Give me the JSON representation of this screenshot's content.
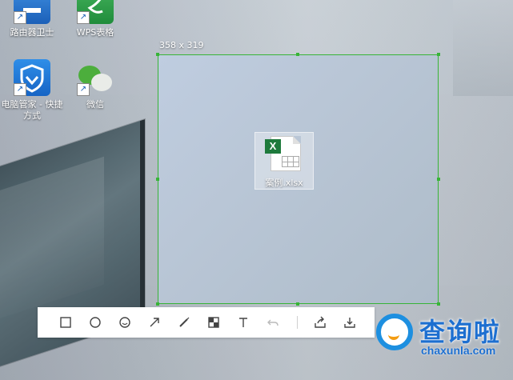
{
  "desktop": {
    "icons": [
      {
        "label": "路由器卫士",
        "icon": "router-guard-icon"
      },
      {
        "label": "WPS表格",
        "icon": "wps-spreadsheet-icon"
      },
      {
        "label": "电脑管家 - 快捷方式",
        "icon": "pc-manager-icon"
      },
      {
        "label": "微信",
        "icon": "wechat-icon"
      }
    ]
  },
  "capture": {
    "size_label": "358 x 319",
    "accent_color": "#37b437"
  },
  "file": {
    "name": "案例.xlsx",
    "badge": "X",
    "icon": "excel-file-icon"
  },
  "toolbar": {
    "tools": [
      {
        "name": "rectangle-tool",
        "icon": "square-icon"
      },
      {
        "name": "ellipse-tool",
        "icon": "circle-icon"
      },
      {
        "name": "emoji-tool",
        "icon": "smiley-icon"
      },
      {
        "name": "arrow-tool",
        "icon": "arrow-icon"
      },
      {
        "name": "pen-tool",
        "icon": "brush-icon"
      },
      {
        "name": "mosaic-tool",
        "icon": "mosaic-icon"
      },
      {
        "name": "text-tool",
        "icon": "text-icon"
      },
      {
        "name": "undo-button",
        "icon": "undo-icon"
      },
      {
        "name": "share-button",
        "icon": "share-icon"
      },
      {
        "name": "save-button",
        "icon": "download-icon"
      }
    ]
  },
  "watermark": {
    "title": "查询啦",
    "domain": "chaxunla.com"
  }
}
